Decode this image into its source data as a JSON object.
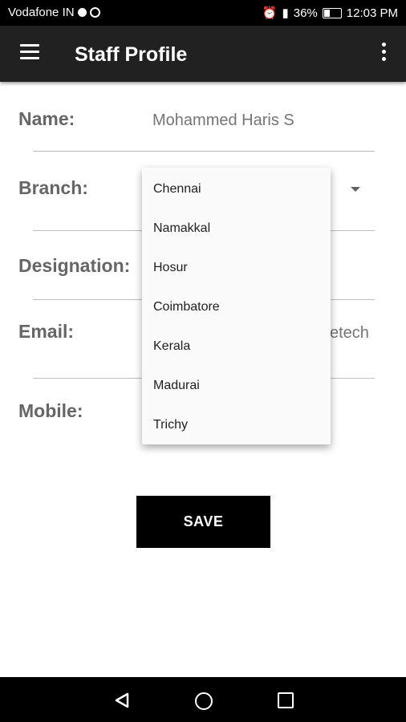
{
  "status_bar": {
    "carrier": "Vodafone IN",
    "battery": "36%",
    "time": "12:03 PM"
  },
  "app_bar": {
    "title": "Staff Profile"
  },
  "form": {
    "name_label": "Name:",
    "name_value": "Mohammed Haris S",
    "branch_label": "Branch:",
    "designation_label": "Designation:",
    "email_label": "Email:",
    "email_value_partial": "etech",
    "mobile_label": "Mobile:"
  },
  "branch_dropdown": {
    "options": [
      "Chennai",
      "Namakkal",
      "Hosur",
      "Coimbatore",
      "Kerala",
      "Madurai",
      "Trichy"
    ]
  },
  "actions": {
    "save_label": "SAVE"
  },
  "icons": {
    "menu": "hamburger-menu-icon",
    "more": "more-vertical-icon",
    "dropdown": "caret-down-icon",
    "nav_back": "back-triangle-icon",
    "nav_home": "home-circle-icon",
    "nav_recent": "recent-square-icon"
  },
  "colors": {
    "app_bar": "#212121",
    "button": "#000000",
    "label": "#666666"
  }
}
